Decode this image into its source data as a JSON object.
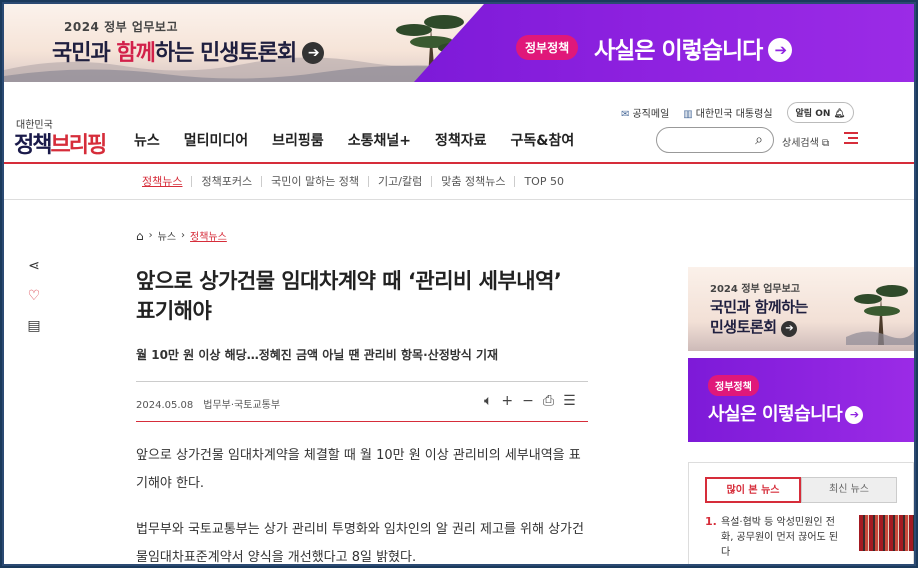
{
  "banner": {
    "small": "2024 정부 업무보고",
    "big_part1": "국민과 ",
    "big_accent": "함께",
    "big_part2": "하는 민생토론회",
    "arrow": "➔",
    "pill": "정부정책",
    "fact": "사실은 이렇습니다",
    "fact_arrow": "➔"
  },
  "header": {
    "logo_sub": "대한민국",
    "logo_a": "정책",
    "logo_b": "브리핑",
    "gnb": [
      "뉴스",
      "멀티미디어",
      "브리핑룸",
      "소통채널+",
      "정책자료",
      "구독&참여"
    ],
    "util": {
      "mail": "공직메일",
      "office": "대한민국 대통령실",
      "alarm": "알림 ON"
    },
    "search_placeholder": "",
    "adv_search": "상세검색"
  },
  "subnav": [
    "정책뉴스",
    "정책포커스",
    "국민이 말하는 정책",
    "기고/칼럼",
    "맞춤 정책뉴스",
    "TOP 50"
  ],
  "breadcrumb": {
    "level1": "뉴스",
    "current": "정책뉴스"
  },
  "article": {
    "title": "앞으로 상가건물 임대차계약 때 ‘관리비 세부내역’ 표기해야",
    "subtitle": "월 10만 원 이상 해당…정혜진 금액 아닐 땐 관리비 항목·산정방식 기재",
    "date": "2024.05.08",
    "org": "법무부·국토교통부",
    "para1": "앞으로 상가건물 임대차계약을 체결할 때 월 10만 원 이상 관리비의 세부내역을 표기해야 한다.",
    "para2": "법무부와 국토교통부는 상가 관리비 투명화와 임차인의 알 권리 제고를 위해 상가건물임대차표준계약서 양식을 개선했다고 8일 밝혔다."
  },
  "sidebar": {
    "ad1_small": "2024 정부 업무보고",
    "ad1_line1": "국민과 함께하는",
    "ad1_line2": "민생토론회",
    "ad1_arrow": "➔",
    "ad2_pill": "정부정책",
    "ad2_title": "사실은 이렇습니다",
    "ad2_arrow": "➔",
    "tab_popular": "많이 본 뉴스",
    "tab_latest": "최신 뉴스",
    "news": [
      {
        "num": "1.",
        "text": "욕설·협박 등 악성민원인 전화, 공무원이 먼저 끊어도 된다"
      }
    ]
  },
  "colors": {
    "accent": "#d62d3a",
    "banner_purple": "#8f22e0",
    "pill_pink": "#e0187a"
  }
}
